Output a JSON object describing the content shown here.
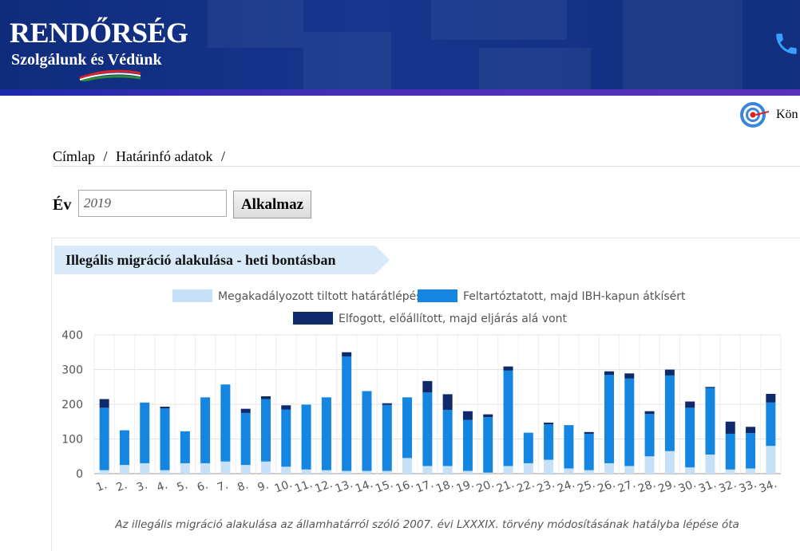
{
  "header": {
    "logo_title": "RENDŐRSÉG",
    "logo_subtitle": "Szolgálunk és Védünk",
    "phone_icon": "phone-icon",
    "brand_color": "#13307f"
  },
  "top_link": {
    "icon": "target-icon",
    "label": "Kön"
  },
  "breadcrumb": {
    "home": "Címlap",
    "sep": "/",
    "section": "Határinfó adatok"
  },
  "filter": {
    "year_label": "Év",
    "year_value": "2019",
    "apply_label": "Alkalmaz"
  },
  "chart_panel": {
    "title": "Illegális migráció alakulása - heti bontásban",
    "caption": "Az illegális migráció alakulása az államhatárról szóló 2007. évi LXXXIX. törvény módosításának hatályba lépése óta"
  },
  "chart_data": {
    "type": "bar",
    "stacked": true,
    "categories": [
      "1.",
      "2.",
      "3.",
      "4.",
      "5.",
      "6.",
      "7.",
      "8.",
      "9.",
      "10.",
      "11.",
      "12.",
      "13.",
      "14.",
      "15.",
      "16.",
      "17.",
      "18.",
      "19.",
      "20.",
      "21.",
      "22.",
      "23.",
      "24.",
      "25.",
      "26.",
      "27.",
      "28.",
      "29.",
      "30.",
      "31.",
      "32.",
      "33.",
      "34."
    ],
    "series": [
      {
        "name": "Megakadályozott tiltott határátlépés",
        "color": "#c6e0f7",
        "values": [
          10,
          25,
          30,
          10,
          30,
          30,
          35,
          25,
          35,
          20,
          12,
          10,
          8,
          8,
          8,
          45,
          22,
          22,
          8,
          3,
          22,
          30,
          40,
          15,
          10,
          30,
          22,
          50,
          65,
          18,
          55,
          12,
          15,
          80
        ]
      },
      {
        "name": "Feltartóztatott, majd IBH-kapun átkísért",
        "color": "#1485e0",
        "values": [
          180,
          100,
          175,
          178,
          92,
          190,
          222,
          150,
          180,
          165,
          187,
          210,
          330,
          230,
          190,
          175,
          212,
          162,
          147,
          160,
          275,
          88,
          102,
          125,
          105,
          255,
          252,
          122,
          218,
          172,
          192,
          103,
          102,
          125
        ]
      },
      {
        "name": "Elfogott, előállított, majd eljárás alá vont",
        "color": "#0e2a6b",
        "values": [
          25,
          0,
          0,
          5,
          0,
          0,
          0,
          12,
          8,
          12,
          0,
          0,
          12,
          0,
          5,
          0,
          33,
          45,
          25,
          8,
          12,
          0,
          5,
          0,
          5,
          10,
          15,
          8,
          17,
          18,
          3,
          35,
          18,
          25
        ]
      }
    ],
    "ylim": [
      0,
      400
    ],
    "yticks": [
      0,
      100,
      200,
      300,
      400
    ],
    "grid": true,
    "legend_position": "top"
  }
}
